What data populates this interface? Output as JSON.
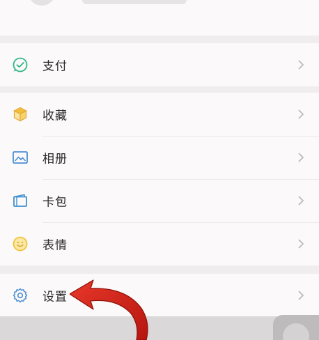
{
  "menu": {
    "pay": {
      "label": "支付",
      "icon": "wechat-pay-icon"
    },
    "favorites": {
      "label": "收藏",
      "icon": "favorites-cube-icon"
    },
    "album": {
      "label": "相册",
      "icon": "album-image-icon"
    },
    "card_wallet": {
      "label": "卡包",
      "icon": "card-wallet-icon"
    },
    "stickers": {
      "label": "表情",
      "icon": "emoji-smile-icon"
    },
    "settings": {
      "label": "设置",
      "icon": "gear-icon"
    }
  },
  "colors": {
    "background": "#efeded",
    "row_background": "#fbf9f9",
    "pay_green": "#2fb685",
    "favorites_yellow": "#f3bf3b",
    "album_blue": "#4a8fd6",
    "card_blue": "#3d90d1",
    "emoji_yellow": "#f1c33a",
    "gear_blue": "#4b8dd3",
    "arrow_red": "#d4241a"
  }
}
